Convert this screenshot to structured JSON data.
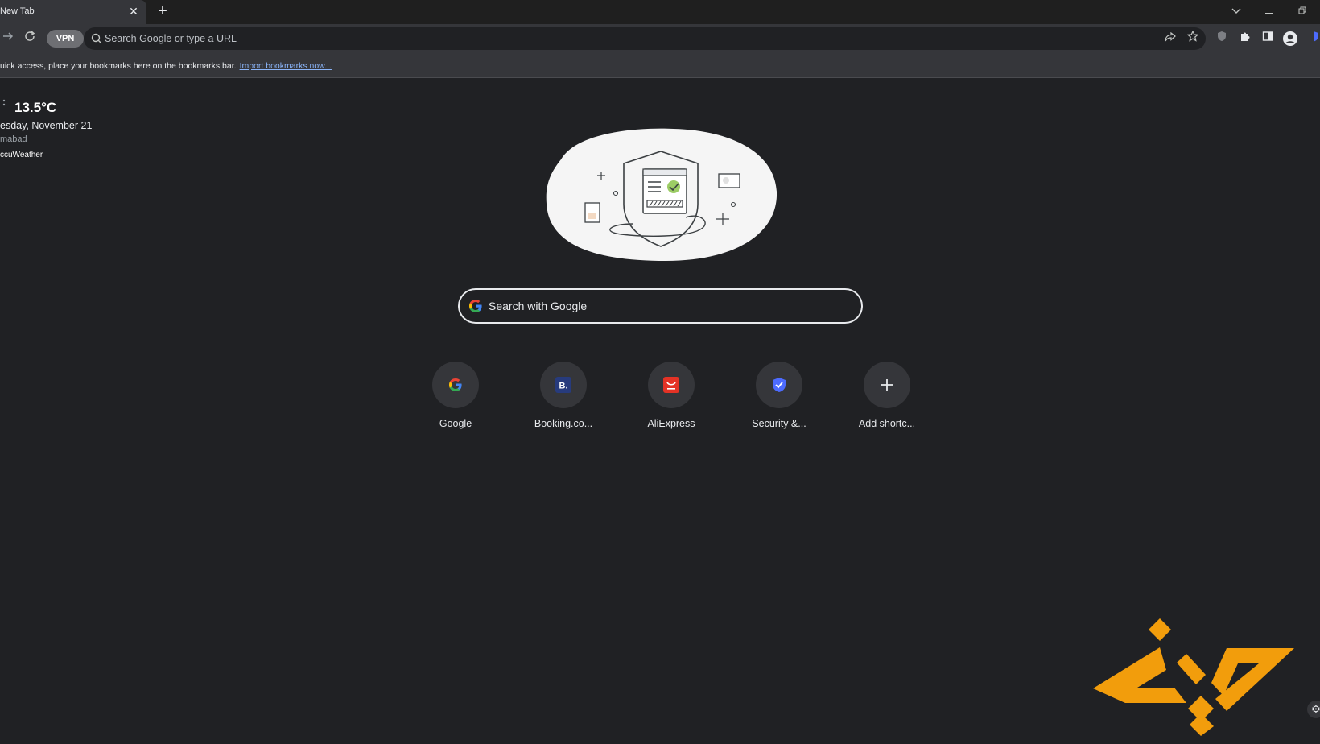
{
  "tab": {
    "title": "New Tab"
  },
  "toolbar": {
    "vpn_label": "VPN",
    "omnibox_placeholder": "Search Google or type a URL"
  },
  "bookmarks_bar": {
    "message": "uick access, place your bookmarks here on the bookmarks bar.",
    "link": "Import bookmarks now..."
  },
  "weather": {
    "temperature": "13.5°C",
    "date": "esday, November 21",
    "city": "mabad",
    "source": "ccuWeather"
  },
  "search": {
    "placeholder": "Search with Google"
  },
  "shortcuts": [
    {
      "label": "Google",
      "icon": "google-icon"
    },
    {
      "label": "Booking.co...",
      "icon": "booking-icon"
    },
    {
      "label": "AliExpress",
      "icon": "aliexpress-icon"
    },
    {
      "label": "Security &...",
      "icon": "security-shield-icon"
    },
    {
      "label": "Add shortc...",
      "icon": "plus-icon"
    }
  ],
  "colors": {
    "background": "#202124",
    "toolbar": "#35363a",
    "link": "#8ab4f8",
    "watermark": "#f29d0c"
  }
}
